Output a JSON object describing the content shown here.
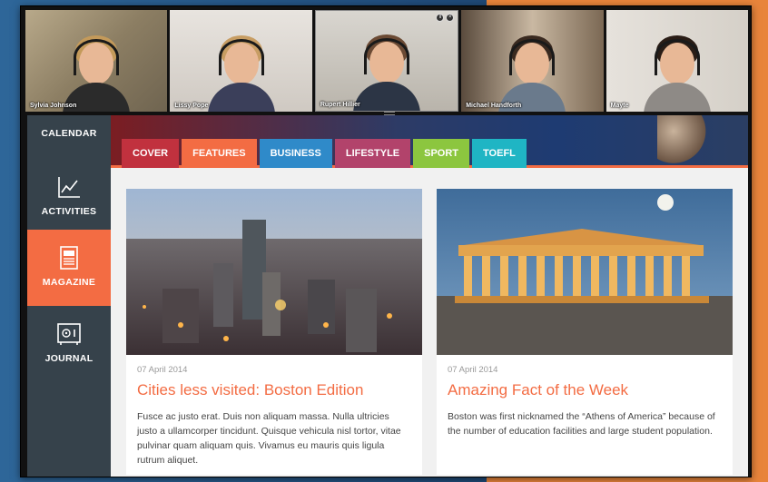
{
  "participants": [
    {
      "name": "Sylvia Johnson"
    },
    {
      "name": "Lissy Pope"
    },
    {
      "name": "Rupert Hillier"
    },
    {
      "name": "Michael Handforth"
    },
    {
      "name": "Mayte"
    }
  ],
  "sidebar": {
    "items": [
      {
        "label": "CALENDAR",
        "icon": "calendar-icon"
      },
      {
        "label": "ACTIVITIES",
        "icon": "activity-chart-icon"
      },
      {
        "label": "MAGAZINE",
        "icon": "magazine-icon",
        "active": true
      },
      {
        "label": "JOURNAL",
        "icon": "journal-icon"
      }
    ]
  },
  "tabs": [
    {
      "label": "COVER",
      "color": "#c1313e"
    },
    {
      "label": "FEATURES",
      "color": "#f36c43",
      "active": true
    },
    {
      "label": "BUSINESS",
      "color": "#2f8ac9"
    },
    {
      "label": "LIFESTYLE",
      "color": "#b2436b"
    },
    {
      "label": "SPORT",
      "color": "#8cc63f"
    },
    {
      "label": "TOEFL",
      "color": "#1fb5c4"
    }
  ],
  "articles": [
    {
      "date": "07 April 2014",
      "title": "Cities less visited: Boston Edition",
      "text": "Fusce ac justo erat. Duis non aliquam massa. Nulla ultricies justo a ullamcorper tincidunt. Quisque vehicula nisl tortor, vitae pulvinar quam aliquam quis. Vivamus eu mauris quis ligula rutrum aliquet."
    },
    {
      "date": "07 April 2014",
      "title": "Amazing Fact of the Week",
      "text": "Boston was first nicknamed the “Athens of America” because of the number of education facilities and large student population."
    }
  ],
  "colors": {
    "accent": "#f36c43",
    "sidebar": "#36424b"
  }
}
